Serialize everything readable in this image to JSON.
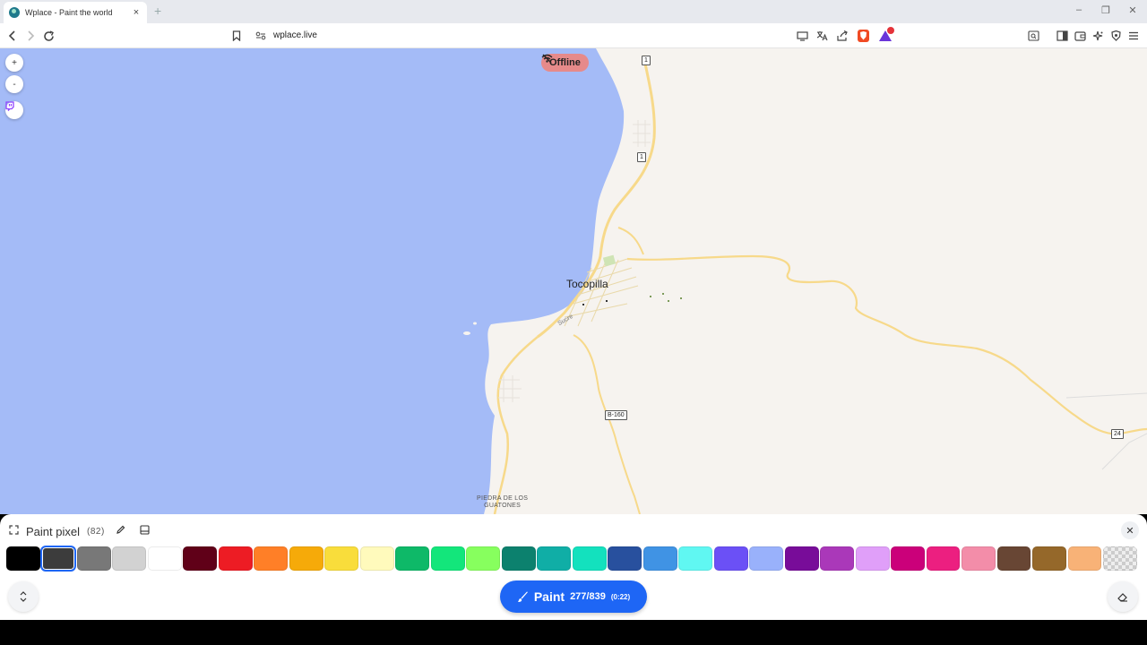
{
  "browser": {
    "tab_title": "Wplace - Paint the world",
    "tab_close": "×",
    "new_tab": "+",
    "url": "wplace.live",
    "window_controls": {
      "minimize": "–",
      "restore": "❐",
      "close": "✕"
    }
  },
  "map": {
    "offline_label": "Offline",
    "zoom_in": "+",
    "zoom_out": "-",
    "city": "Tocopilla",
    "street": "Sucre",
    "place": "PIEDRA DE LOS\nGUATONES",
    "shields": [
      "1",
      "1",
      "B-160",
      "24"
    ],
    "colors": {
      "sea": "#a4bbf7",
      "land": "#f6f3ef",
      "road": "#f7d98a",
      "twitch": "#9146ff"
    }
  },
  "panel": {
    "title": "Paint pixel",
    "count": "(82)",
    "close": "✕",
    "paint_label": "Paint",
    "paint_count": "277/839",
    "paint_time": "(0:22)",
    "selected_index": 1,
    "palette": [
      "#000000",
      "#3c3c3c",
      "#787878",
      "#d2d2d2",
      "#ffffff",
      "#600018",
      "#ed1c24",
      "#ff7f27",
      "#f6aa09",
      "#f9dd3b",
      "#fffabc",
      "#0eb968",
      "#13e67b",
      "#87ff5e",
      "#0c816e",
      "#10aea6",
      "#13e1be",
      "#28509e",
      "#4093e4",
      "#60f7f2",
      "#6b50f6",
      "#99b1fb",
      "#780c99",
      "#aa38b9",
      "#e09ff9",
      "#cb007a",
      "#ec1f80",
      "#f38da9",
      "#684634",
      "#95682a",
      "#f8b277",
      "transparent"
    ]
  }
}
